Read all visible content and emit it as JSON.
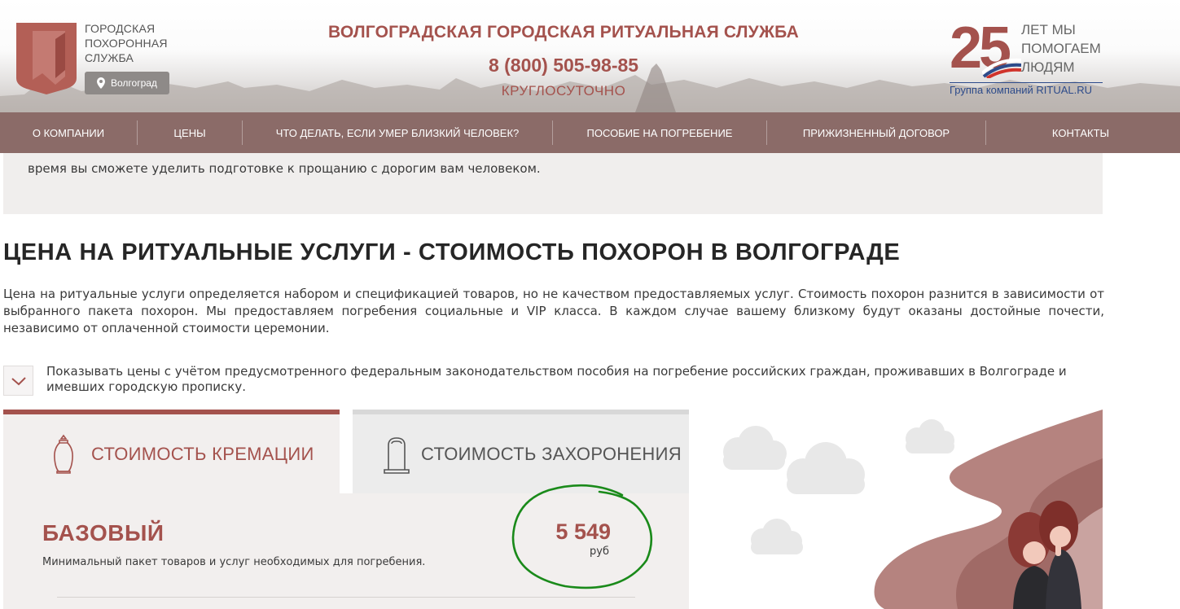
{
  "header": {
    "logo_lines": [
      "ГОРОДСКАЯ",
      "ПОХОРОННАЯ",
      "СЛУЖБА"
    ],
    "city": "Волгоград",
    "title": "ВОЛГОГРАДСКАЯ ГОРОДСКАЯ РИТУАЛЬНАЯ СЛУЖБА",
    "phone": "8 (800) 505-98-85",
    "hours": "КРУГЛОСУТОЧНО",
    "badge": {
      "number": "25",
      "words": [
        "ЛЕТ МЫ",
        "ПОМОГАЕМ",
        "ЛЮДЯМ"
      ],
      "group": "Группа компаний RITUAL.RU"
    }
  },
  "nav": {
    "items": [
      "О КОМПАНИИ",
      "ЦЕНЫ",
      "ЧТО ДЕЛАТЬ, ЕСЛИ УМЕР БЛИЗКИЙ ЧЕЛОВЕК?",
      "ПОСОБИЕ НА ПОГРЕБЕНИЕ",
      "ПРИЖИЗНЕННЫЙ ДОГОВОР",
      "КОНТАКТЫ"
    ]
  },
  "intro": {
    "text": "время вы сможете уделить подготовке к прощанию с дорогим вам человеком."
  },
  "main": {
    "heading": "ЦЕНА НА РИТУАЛЬНЫЕ УСЛУГИ - СТОИМОСТЬ ПОХОРОН В ВОЛГОГРАДЕ",
    "paragraph": "Цена на ритуальные услуги определяется набором и спецификацией товаров, но не качеством предоставляемых услуг. Стоимость похорон разнится в зависимости от выбранного пакета похорон. Мы предоставляем погребения социальные и VIP класса. В каждом случае вашему близкому будут оказаны достойные почести, независимо от оплаченной стоимости церемонии.",
    "checkbox_label": "Показывать цены с учётом предусмотренного федеральным законодательством пособия на погребение российских граждан, проживавших в Волгограде и имевших городскую прописку.",
    "checkbox_checked": true
  },
  "tabs": {
    "cremation": "СТОИМОСТЬ КРЕМАЦИИ",
    "burial": "СТОИМОСТЬ ЗАХОРОНЕНИЯ",
    "active": "cremation"
  },
  "package": {
    "name": "БАЗОВЫЙ",
    "description": "Минимальный пакет товаров и услуг необходимых для погребения.",
    "price": "5 549",
    "currency": "руб"
  },
  "colors": {
    "accent": "#a4524d",
    "nav_bg": "#82605c",
    "annotation": "#1a8a1a"
  }
}
